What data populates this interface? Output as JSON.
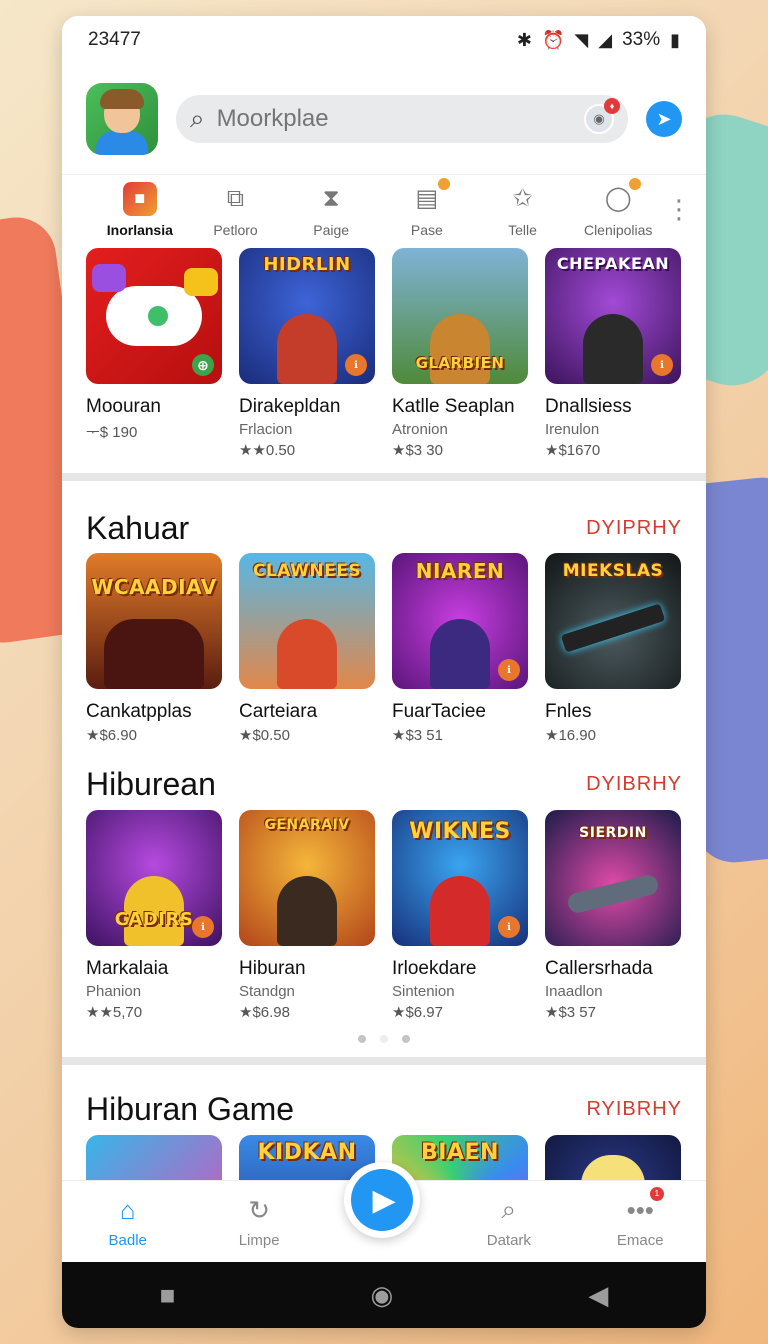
{
  "status": {
    "time": "23477",
    "battery": "33%"
  },
  "search": {
    "placeholder": "Moorkplae"
  },
  "categories": [
    {
      "label": "Inorlansia",
      "active": true
    },
    {
      "label": "Petloro"
    },
    {
      "label": "Paige"
    },
    {
      "label": "Pase"
    },
    {
      "label": "Telle"
    },
    {
      "label": "Clenipolias"
    }
  ],
  "top_row": [
    {
      "title": "Moouran",
      "sub": "",
      "rating": "ᅮ$ 190",
      "art": ""
    },
    {
      "title": "Dirakepldan",
      "sub": "Frlacion",
      "rating": "★★0.50",
      "art": "HIDRLIN"
    },
    {
      "title": "Katlle Seaplan",
      "sub": "Atronion",
      "rating": "★$3 30",
      "art": "GLARBIEN"
    },
    {
      "title": "Dnallsiess",
      "sub": "Irenulon",
      "rating": "★$1670",
      "art": "CHEPAKEAN"
    }
  ],
  "sections": [
    {
      "title": "Kahuar",
      "link": "DYIPRHY",
      "items": [
        {
          "title": "Cankatpplas",
          "sub": "",
          "rating": "★$6.90",
          "art": "WCAADIAV"
        },
        {
          "title": "Carteiara",
          "sub": "",
          "rating": "★$0.50",
          "art": "CLAWNEES"
        },
        {
          "title": "FuarTaciee",
          "sub": "",
          "rating": "★$3 51",
          "art": "NIAREN"
        },
        {
          "title": "Fnles",
          "sub": "",
          "rating": "★16.90",
          "art": "MIEKSLAS"
        }
      ]
    },
    {
      "title": "Hiburean",
      "link": "DYIBRHY",
      "items": [
        {
          "title": "Markalaia",
          "sub": "Phanion",
          "rating": "★★5,70",
          "art": "CADIRS"
        },
        {
          "title": "Hiburan",
          "sub": "Standgn",
          "rating": "★$6.98",
          "art": "GENARAIV"
        },
        {
          "title": "Irloekdare",
          "sub": "Sintenion",
          "rating": "★$6.97",
          "art": "WIKNES"
        },
        {
          "title": "Callersrhada",
          "sub": "Inaadlon",
          "rating": "★$3 57",
          "art": "SIERDIN"
        }
      ]
    },
    {
      "title": "Hiburan Game",
      "link": "RYIBRHY",
      "items": [
        {
          "art": ""
        },
        {
          "art": "KIDKAN"
        },
        {
          "art": "BIAEN"
        },
        {
          "art": ""
        }
      ]
    }
  ],
  "bottom_nav": [
    {
      "label": "Badle",
      "active": true
    },
    {
      "label": "Limpe"
    },
    {
      "label": "Datark"
    },
    {
      "label": "Emace"
    }
  ],
  "colors": {
    "accent": "#2196f3",
    "link": "#d63b2f"
  }
}
